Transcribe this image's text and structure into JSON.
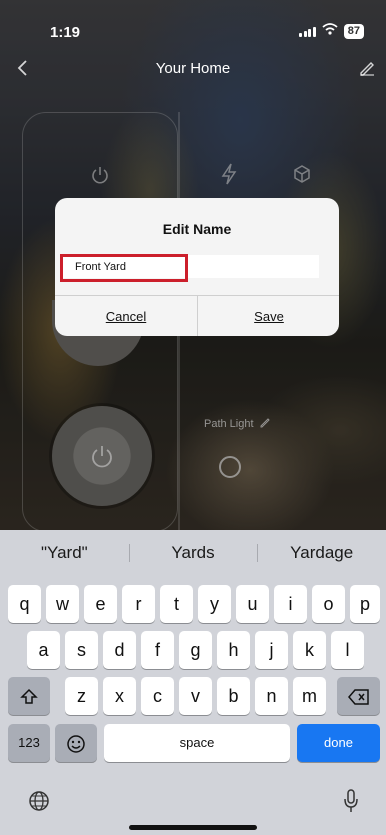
{
  "status_bar": {
    "time": "1:19",
    "battery": "87"
  },
  "nav": {
    "title": "Your Home"
  },
  "background": {
    "light_label": "Path Light"
  },
  "dialog": {
    "title": "Edit Name",
    "input_value": "Front Yard",
    "cancel_label": "Cancel",
    "save_label": "Save",
    "highlight_color": "#cc1f2b"
  },
  "keyboard": {
    "suggestions": [
      "\"Yard\"",
      "Yards",
      "Yardage"
    ],
    "row1": [
      "q",
      "w",
      "e",
      "r",
      "t",
      "y",
      "u",
      "i",
      "o",
      "p"
    ],
    "row2": [
      "a",
      "s",
      "d",
      "f",
      "g",
      "h",
      "j",
      "k",
      "l"
    ],
    "row3": [
      "z",
      "x",
      "c",
      "v",
      "b",
      "n",
      "m"
    ],
    "numbers_label": "123",
    "space_label": "space",
    "done_label": "done",
    "done_color": "#1877f2",
    "icons": [
      "shift-icon",
      "delete-icon",
      "emoji-icon",
      "globe-icon",
      "microphone-icon"
    ]
  }
}
